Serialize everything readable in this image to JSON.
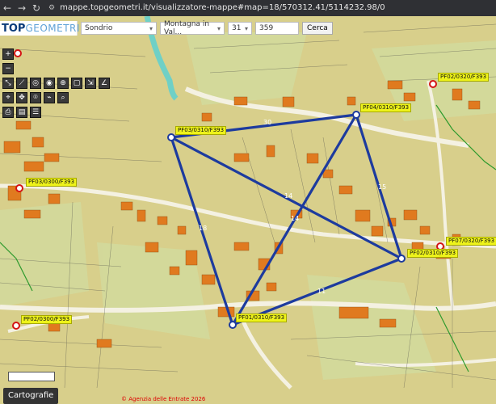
{
  "browser": {
    "url": "mappe.topgeometri.it/visualizzatore-mappe#map=18/570312.41/5114232.98/0"
  },
  "topbar": {
    "logo_top": "TOP",
    "logo_geometri": "GEOMETRI",
    "province": "Sondrio",
    "municipality": "Montagna in Val...",
    "sheet": "31",
    "parcel": "359",
    "search_label": "Cerca"
  },
  "map_labels": {
    "pf03_0310": "PF03/0310/F393",
    "pf04_0310": "PF04/0310/F393",
    "pf02_0320": "PF02/0320/F393",
    "pf03_0300": "PF03/0300/F393",
    "pf07_0320": "PF07/0320/F393",
    "pf02_0310": "PF02/0310/F393",
    "pf01_0310": "PF01/0310/F393",
    "pf02_0300": "PF02/0300/F393"
  },
  "distances": {
    "d_top": "30",
    "d_right": "15",
    "d_center1": "14",
    "d_center2": "14",
    "d_leftdiag": "18",
    "d_bottom": "11"
  },
  "ui": {
    "bottom_button": "Cartografie",
    "copyright": "© Agenzia delle Entrate 2026"
  },
  "colors": {
    "triangulation": "#1d3b9e",
    "building": "#e07a1f",
    "label_bg": "#eef31a"
  },
  "icons": {
    "zoom_in": "plus-icon",
    "zoom_out": "minus-icon",
    "measure": "ruler-icon",
    "print": "printer-icon",
    "layers": "layers-icon"
  }
}
